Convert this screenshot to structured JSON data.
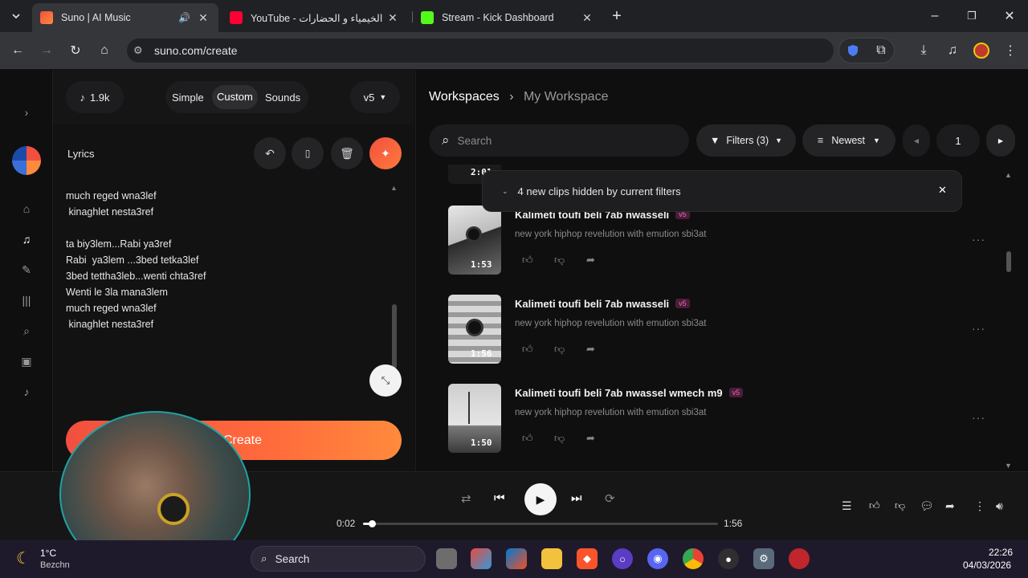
{
  "browser": {
    "tabs": [
      {
        "title": "Suno | AI Music",
        "active": true
      },
      {
        "title": "YouTube - الخيمياء و الحضارات !",
        "active": false
      },
      {
        "title": "Stream - Kick Dashboard",
        "active": false
      }
    ],
    "url": "suno.com/create"
  },
  "left_panel": {
    "credits": "1.9k",
    "modes": [
      "Simple",
      "Custom",
      "Sounds"
    ],
    "selected_mode": "Custom",
    "model": "v5",
    "lyrics_label": "Lyrics",
    "lyrics_text": "much reged wna3lef\n kinaghlet nesta3ref\n\nta biy3lem...Rabi ya3ref\nRabi  ya3lem ...3bed tetka3lef\n3bed tettha3leb...wenti chta3ref\nWenti le 3la mana3lem\nmuch reged wna3lef\n kinaghlet nesta3ref",
    "create_label": "Create"
  },
  "workspace": {
    "breadcrumb_root": "Workspaces",
    "breadcrumb_current": "My Workspace",
    "search_placeholder": "Search",
    "filters_label": "Filters (3)",
    "sort_label": "Newest",
    "page": "1",
    "hidden_notice": "4 new clips hidden by current filters",
    "partial_duration": "2:01",
    "clips": [
      {
        "title": "Kalimeti toufi beli 7ab nwasseli",
        "version": "v5",
        "style": "new york hiphop revelution with emution sbi3at",
        "duration": "1:53"
      },
      {
        "title": "Kalimeti toufi beli 7ab nwasseli",
        "version": "v5",
        "style": "new york hiphop revelution with emution sbi3at",
        "duration": "1:56"
      },
      {
        "title": "Kalimeti toufi beli 7ab nwassel wmech m9",
        "version": "v5",
        "style": "new york hiphop revelution with emution sbi3at",
        "duration": "1:50"
      }
    ]
  },
  "player": {
    "elapsed": "0:02",
    "total": "1:56",
    "progress": 0.017
  },
  "taskbar": {
    "weather_temp": "1°C",
    "weather_place": "Bezchn",
    "search_label": "Search",
    "time": "22:26",
    "date": "04/03/2026"
  },
  "colors": {
    "accent_gradient_start": "#f2503f",
    "accent_gradient_end": "#ff8a3c",
    "version_badge": "#e86aa8"
  }
}
